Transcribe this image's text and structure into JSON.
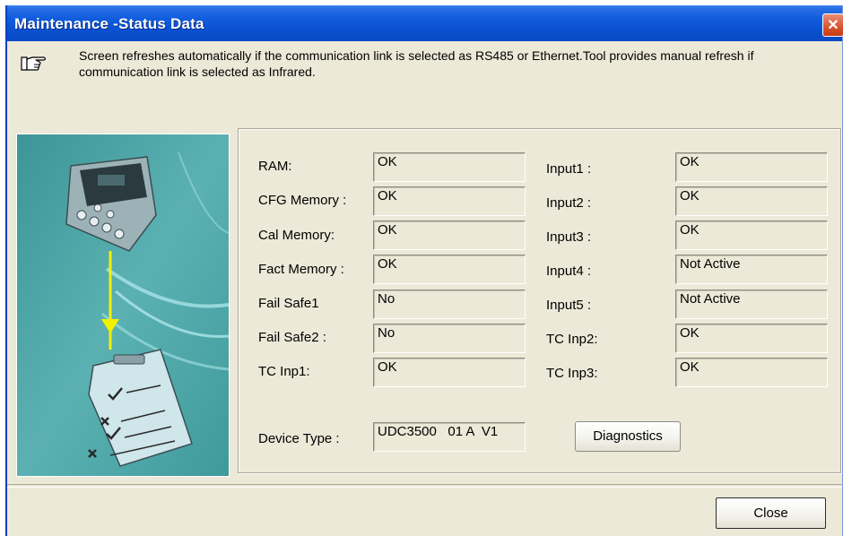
{
  "window": {
    "title": "Maintenance -Status Data",
    "close_glyph": "✕"
  },
  "info": {
    "icon": "pointing-hand-icon",
    "text": "Screen refreshes automatically if the communication link is selected as RS485 or Ethernet.Tool provides manual refresh if communication link is selected as Infrared."
  },
  "illustration": {
    "icon": "controller-to-checklist-illustration",
    "background": "#4b9fa1"
  },
  "status": {
    "left": [
      {
        "label": "RAM:",
        "value": "OK"
      },
      {
        "label": "CFG Memory :",
        "value": "OK"
      },
      {
        "label": "Cal Memory:",
        "value": "OK"
      },
      {
        "label": "Fact Memory :",
        "value": "OK"
      },
      {
        "label": "Fail Safe1",
        "value": "No"
      },
      {
        "label": "Fail Safe2 :",
        "value": "No"
      },
      {
        "label": "TC Inp1:",
        "value": "OK"
      }
    ],
    "right": [
      {
        "label": "Input1 :",
        "value": "OK"
      },
      {
        "label": "Input2 :",
        "value": "OK"
      },
      {
        "label": "Input3 :",
        "value": "OK"
      },
      {
        "label": "Input4 :",
        "value": "Not Active"
      },
      {
        "label": "Input5 :",
        "value": "Not Active"
      },
      {
        "label": "TC Inp2:",
        "value": "OK"
      },
      {
        "label": "TC Inp3:",
        "value": "OK"
      }
    ]
  },
  "device": {
    "label": "Device Type :",
    "value": "UDC3500   01 A  V1"
  },
  "buttons": {
    "diagnostics": "Diagnostics",
    "close": "Close"
  },
  "colors": {
    "titlebar": "#0a4fcf",
    "window_bg": "#ece9d8",
    "close_x": "#d9542e"
  }
}
